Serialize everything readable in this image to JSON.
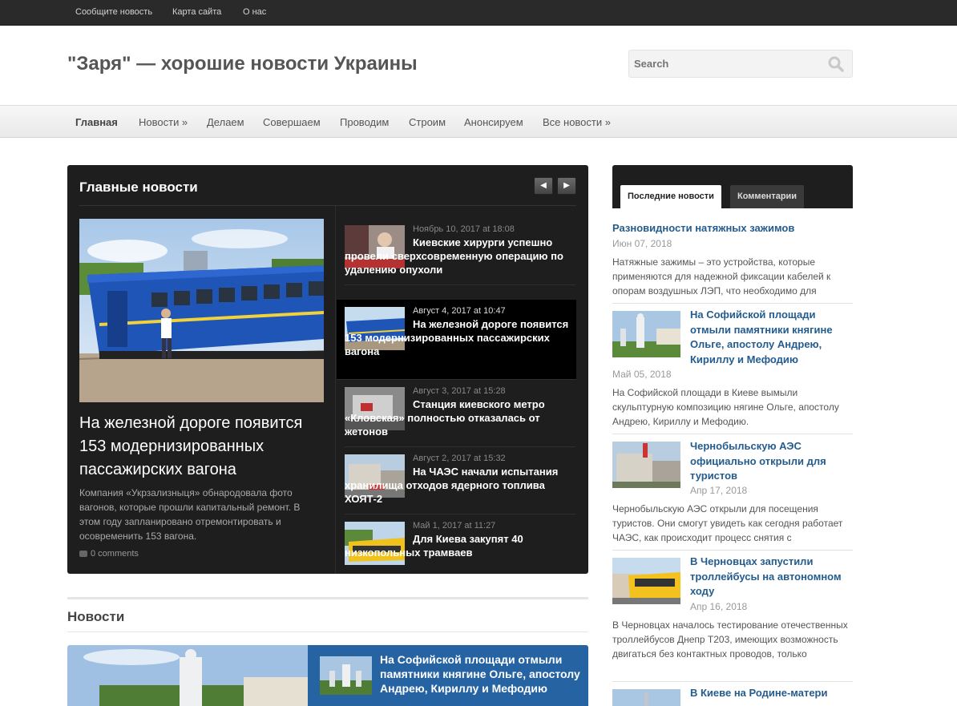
{
  "topbar": {
    "links": [
      "Сообщите новость",
      "Карта сайта",
      "О нас"
    ]
  },
  "header": {
    "site_title": "\"Заря\" — хорошие новости Украины",
    "search_placeholder": "Search"
  },
  "nav": {
    "items": [
      "Главная",
      "Новости »",
      "Делаем",
      "Совершаем",
      "Проводим",
      "Строим",
      "Анонсируем",
      "Все новости »"
    ],
    "active": "Главная"
  },
  "featured": {
    "title": "Главные новости",
    "prev_icon": "triangle-left",
    "next_icon": "triangle-right",
    "main": {
      "headline": "На железной дороге появится 153 модернизированных пассажирских вагона",
      "excerpt": "Компания «Укрзализныця» обнародовала фото вагонов, которые прошли капитальный ремонт. В этом году запланировано отремонтировать и осовременить 153 вагона.",
      "comments": "0 comments"
    },
    "items": [
      {
        "date": "Ноябрь 10, 2017 at 18:08",
        "title": "Киевские хирурги успешно провели сверхсовременную операцию по удалению опухоли",
        "active": false
      },
      {
        "date": "Август 4, 2017 at 10:47",
        "title": "На железной дороге появится 153 модернизированных пассажирских вагона",
        "active": true
      },
      {
        "date": "Август 3, 2017 at 15:28",
        "title": "Станция киевского метро «Кловская» полностью отказалась от жетонов",
        "active": false
      },
      {
        "date": "Август 2, 2017 at 15:32",
        "title": "На ЧАЭС начали испытания хранилища отходов ядерного топлива ХОЯТ-2",
        "active": false
      },
      {
        "date": "Май 1, 2017 at 11:27",
        "title": "Для Киева закупят 40 низкопольных трамваев",
        "active": false
      }
    ]
  },
  "news_section": {
    "title": "Новости",
    "item_title": "На Софийской площади отмыли памятники княгине Ольге, апостолу Андрею, Кириллу и Мефодию"
  },
  "sidebar": {
    "tabs": [
      "Последние новости",
      "Комментарии"
    ],
    "posts": [
      {
        "title": "Разновидности натяжных зажимов",
        "date": "Июн 07, 2018",
        "excerpt": "Натяжные зажимы – это устройства, которые применяются для надежной фиксации кабелей к опорам воздушных ЛЭП, что необходимо для"
      },
      {
        "title": "На Софийской площади отмыли памятники княгине Ольге, апостолу Андрею, Кириллу и Мефодию",
        "date": "Май 05, 2018",
        "excerpt": "На Софийской площади в Киеве вымыли скульптурную композицию нягине Ольге, апостолу Андрею, Кириллу и Мефодию."
      },
      {
        "title": "Чернобыльскую АЭС официально открыли для туристов",
        "date": "Апр 17, 2018",
        "excerpt": "Чернобыльскую АЭС открыли для посещения туристов. Они смогут увидеть как сегодня работает ЧАЭС, как происходит процесс снятия с"
      },
      {
        "title": "В Черновцах запустили троллейбусы на автономном ходу",
        "date": "Апр 16, 2018",
        "excerpt": "В Черновцах началось тестирование отечественных троллейбусов Днепр Т203, имеющих возможность двигаться без контактных проводов, только"
      },
      {
        "title": "В Киеве на Родине-матери"
      }
    ]
  }
}
